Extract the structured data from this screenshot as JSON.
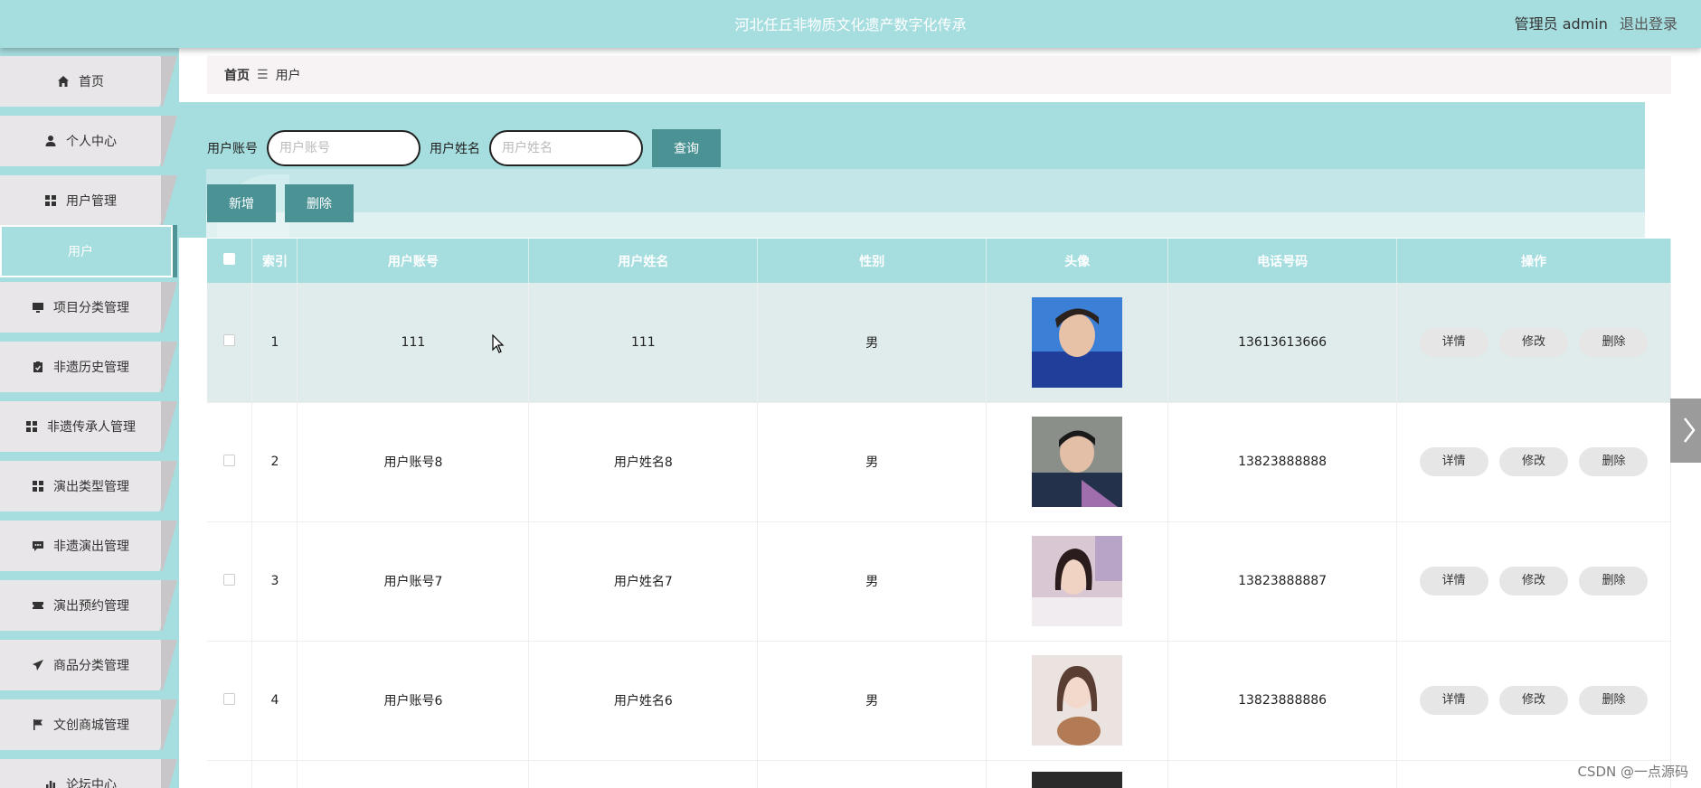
{
  "header": {
    "title": "河北任丘非物质文化遗产数字化传承",
    "user_label": "管理员 admin",
    "logout_label": "退出登录"
  },
  "sidebar": {
    "items": [
      {
        "label": "首页",
        "icon": "home-icon"
      },
      {
        "label": "个人中心",
        "icon": "person-icon"
      },
      {
        "label": "用户管理",
        "icon": "grid-icon"
      },
      {
        "label": "项目分类管理",
        "icon": "monitor-icon"
      },
      {
        "label": "非遗历史管理",
        "icon": "clipboard-icon"
      },
      {
        "label": "非遗传承人管理",
        "icon": "grid-icon"
      },
      {
        "label": "演出类型管理",
        "icon": "grid-icon"
      },
      {
        "label": "非遗演出管理",
        "icon": "chat-icon"
      },
      {
        "label": "演出预约管理",
        "icon": "ticket-icon"
      },
      {
        "label": "商品分类管理",
        "icon": "paper-plane-icon"
      },
      {
        "label": "文创商城管理",
        "icon": "flag-icon"
      },
      {
        "label": "论坛中心",
        "icon": "bar-chart-icon"
      }
    ],
    "active_sub": "用户"
  },
  "breadcrumb": {
    "home": "首页",
    "separator": "☰",
    "current": "用户"
  },
  "search": {
    "account_label": "用户账号",
    "account_placeholder": "用户账号",
    "name_label": "用户姓名",
    "name_placeholder": "用户姓名",
    "query_button": "查询"
  },
  "actions": {
    "add_button": "新增",
    "delete_button": "删除"
  },
  "table": {
    "columns": [
      "索引",
      "用户账号",
      "用户姓名",
      "性别",
      "头像",
      "电话号码",
      "操作"
    ],
    "rows": [
      {
        "index": "1",
        "account": "111",
        "name": "111",
        "gender": "男",
        "phone": "13613613666"
      },
      {
        "index": "2",
        "account": "用户账号8",
        "name": "用户姓名8",
        "gender": "男",
        "phone": "13823888888"
      },
      {
        "index": "3",
        "account": "用户账号7",
        "name": "用户姓名7",
        "gender": "男",
        "phone": "13823888887"
      },
      {
        "index": "4",
        "account": "用户账号6",
        "name": "用户姓名6",
        "gender": "男",
        "phone": "13823888886"
      }
    ],
    "row_buttons": {
      "detail": "详情",
      "edit": "修改",
      "delete": "删除"
    }
  },
  "watermark": "CSDN @一点源码",
  "colors": {
    "accent": "#a6dddf",
    "button": "#4b9294"
  }
}
